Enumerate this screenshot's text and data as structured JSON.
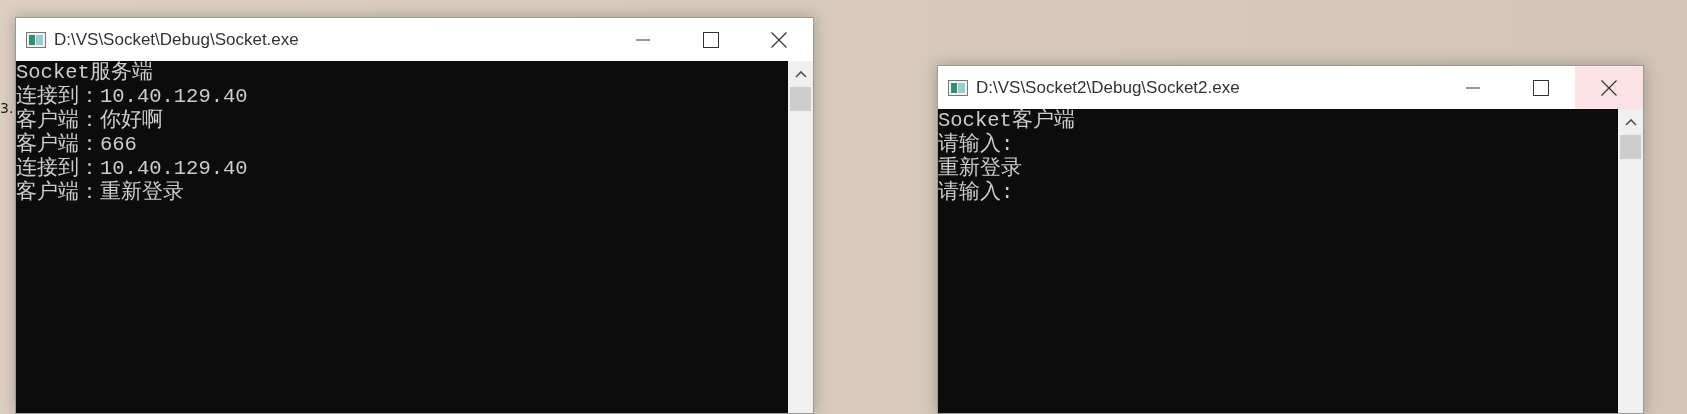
{
  "desktop": {
    "text_fragment": "3."
  },
  "windows": [
    {
      "title": "D:\\VS\\Socket\\Debug\\Socket.exe",
      "close_hovered": false,
      "lines": [
        "Socket服务端",
        "连接到：10.40.129.40",
        "客户端：你好啊",
        "客户端：666",
        "连接到：10.40.129.40",
        "客户端：重新登录"
      ]
    },
    {
      "title": "D:\\VS\\Socket2\\Debug\\Socket2.exe",
      "close_hovered": true,
      "lines": [
        "Socket客户端",
        "请输入:",
        "重新登录",
        "请输入:"
      ]
    }
  ]
}
